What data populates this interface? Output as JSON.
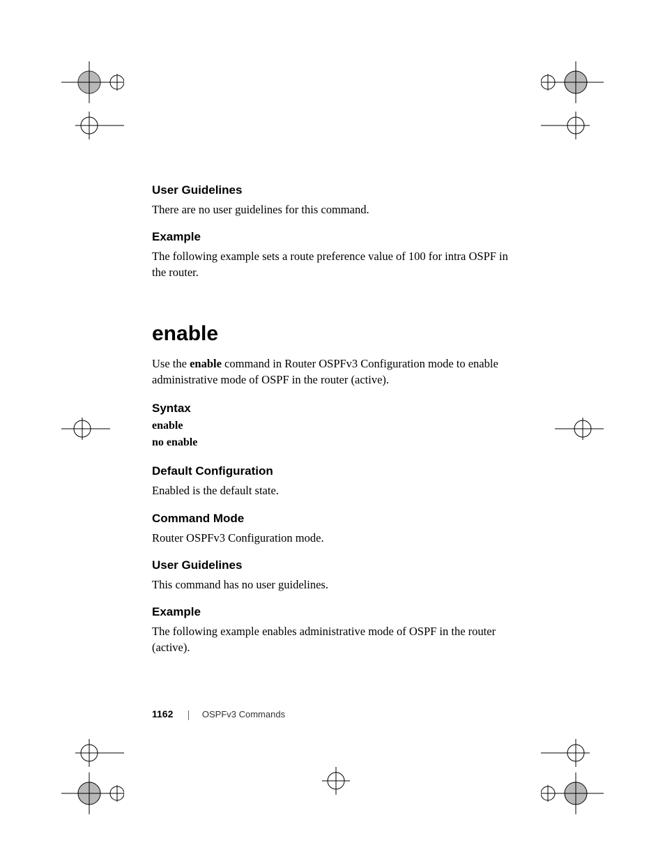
{
  "sections": {
    "user_guidelines_1": {
      "heading": "User Guidelines",
      "text": "There are no user guidelines for this command."
    },
    "example_1": {
      "heading": "Example",
      "text": "The following example sets a route preference value of 100 for intra OSPF in the router."
    }
  },
  "command": {
    "title": "enable",
    "intro_prefix": "Use the ",
    "intro_bold": "enable",
    "intro_suffix": " command in Router OSPFv3 Configuration mode to enable administrative mode of OSPF in the router (active).",
    "syntax": {
      "heading": "Syntax",
      "line1": "enable",
      "line2": "no enable"
    },
    "default_config": {
      "heading": "Default Configuration",
      "text": "Enabled is the default state."
    },
    "command_mode": {
      "heading": "Command Mode",
      "text": "Router OSPFv3 Configuration mode."
    },
    "user_guidelines_2": {
      "heading": "User Guidelines",
      "text": "This command has no user guidelines."
    },
    "example_2": {
      "heading": "Example",
      "text": "The following example enables administrative mode of OSPF in the router (active)."
    }
  },
  "footer": {
    "page": "1162",
    "title": "OSPFv3 Commands"
  }
}
